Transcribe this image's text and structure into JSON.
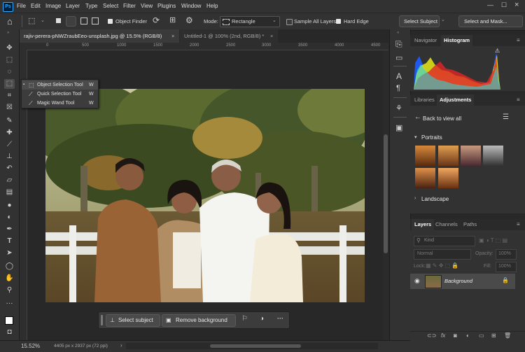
{
  "menu": {
    "logo": "Ps",
    "items": [
      "File",
      "Edit",
      "Image",
      "Layer",
      "Type",
      "Select",
      "Filter",
      "View",
      "Plugins",
      "Window",
      "Help"
    ]
  },
  "options": {
    "object_finder_label": "Object Finder",
    "mode_label": "Mode:",
    "mode_value": "Rectangle",
    "sample_all_layers": "Sample All Layers",
    "hard_edge": "Hard Edge",
    "select_subject": "Select Subject",
    "select_and_mask": "Select and Mask..."
  },
  "tabs": [
    {
      "label": "rajiv-perera-pNWZraubEeo-unsplash.jpg @ 15.5% (RGB/8)",
      "close": "×"
    },
    {
      "label": "Untitled-1 @ 100% (2nd, RGB/8) *",
      "close": "×"
    }
  ],
  "ruler_labels": [
    "0",
    "500",
    "1000",
    "1500",
    "2000",
    "2500",
    "3000",
    "3500",
    "4000",
    "4500"
  ],
  "tool_flyout": [
    {
      "label": "Object Selection Tool",
      "key": "W"
    },
    {
      "label": "Quick Selection Tool",
      "key": "W"
    },
    {
      "label": "Magic Wand Tool",
      "key": "W"
    }
  ],
  "context_bar": {
    "select_subject": "Select subject",
    "remove_background": "Remove background",
    "more": "···"
  },
  "status": {
    "zoom": "15.52%",
    "doc_info": "4405 px x 2937 px (72 ppi)"
  },
  "navigator_panel": {
    "tabs": [
      "Navigator",
      "Histogram"
    ],
    "active": "Histogram"
  },
  "adjustments_panel": {
    "tabs": [
      "Libraries",
      "Adjustments"
    ],
    "active": "Adjustments",
    "back_label": "Back to view all",
    "section_portraits": "Portraits",
    "section_landscape": "Landscape"
  },
  "layers_panel": {
    "tabs": [
      "Layers",
      "Channels",
      "Paths"
    ],
    "active": "Layers",
    "kind_placeholder": "Kind",
    "blend_mode": "Normal",
    "opacity_label": "Opacity:",
    "opacity_value": "100%",
    "lock_label": "Lock:",
    "fill_label": "Fill:",
    "fill_value": "100%",
    "layer_name": "Background"
  },
  "colors": {
    "accent": "#31a8ff",
    "panel_bg": "#323232",
    "app_bg": "#282828"
  }
}
